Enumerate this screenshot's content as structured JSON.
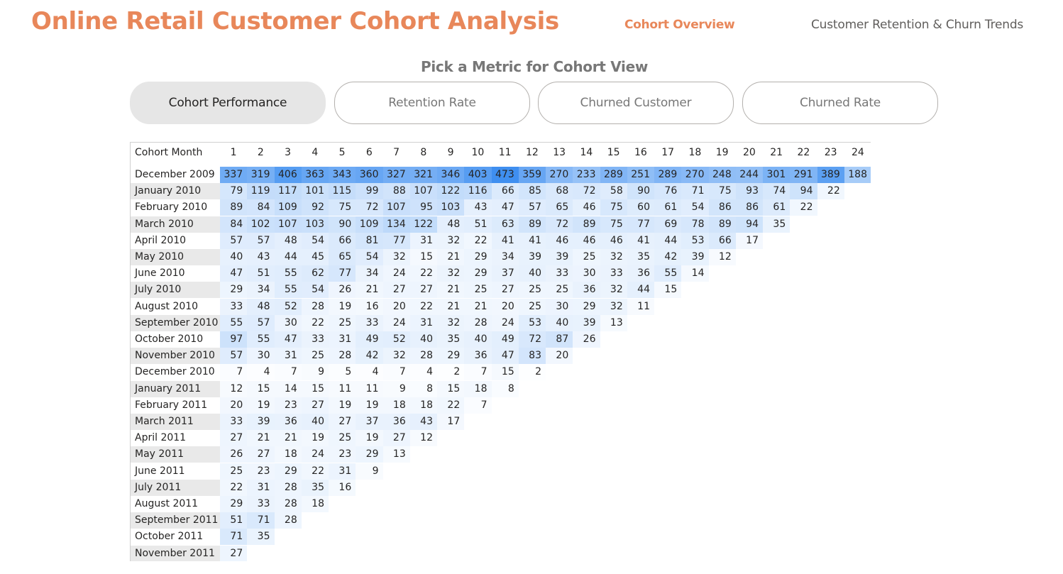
{
  "header": {
    "title": "Online Retail Customer Cohort Analysis",
    "nav_active": "Cohort Overview",
    "nav_inactive": "Customer Retention & Churn Trends"
  },
  "picker": {
    "title": "Pick a Metric for Cohort View",
    "buttons": [
      "Cohort Performance",
      "Retention Rate",
      "Churned Customer",
      "Churned Rate"
    ],
    "selected": "Cohort Performance"
  },
  "colors": {
    "title_accent": "#e8875a",
    "heat_low": "#ffffff",
    "heat_high": "#3f8ff0"
  },
  "table": {
    "corner_label": "Cohort Month",
    "columns": [
      "1",
      "2",
      "3",
      "4",
      "5",
      "6",
      "7",
      "8",
      "9",
      "10",
      "11",
      "12",
      "13",
      "14",
      "15",
      "16",
      "17",
      "18",
      "19",
      "20",
      "21",
      "22",
      "23",
      "24"
    ],
    "rows": [
      {
        "label": "December 2009",
        "values": [
          337,
          319,
          406,
          363,
          343,
          360,
          327,
          321,
          346,
          403,
          473,
          359,
          270,
          233,
          289,
          251,
          289,
          270,
          248,
          244,
          301,
          291,
          389,
          188
        ]
      },
      {
        "label": "January 2010",
        "values": [
          79,
          119,
          117,
          101,
          115,
          99,
          88,
          107,
          122,
          116,
          66,
          85,
          68,
          72,
          58,
          90,
          76,
          71,
          75,
          93,
          74,
          94,
          22
        ]
      },
      {
        "label": "February 2010",
        "values": [
          89,
          84,
          109,
          92,
          75,
          72,
          107,
          95,
          103,
          43,
          47,
          57,
          65,
          46,
          75,
          60,
          61,
          54,
          86,
          86,
          61,
          22
        ]
      },
      {
        "label": "March 2010",
        "values": [
          84,
          102,
          107,
          103,
          90,
          109,
          134,
          122,
          48,
          51,
          63,
          89,
          72,
          89,
          75,
          77,
          69,
          78,
          89,
          94,
          35
        ]
      },
      {
        "label": "April 2010",
        "values": [
          57,
          57,
          48,
          54,
          66,
          81,
          77,
          31,
          32,
          22,
          41,
          41,
          46,
          46,
          46,
          41,
          44,
          53,
          66,
          17
        ]
      },
      {
        "label": "May 2010",
        "values": [
          40,
          43,
          44,
          45,
          65,
          54,
          32,
          15,
          21,
          29,
          34,
          39,
          39,
          25,
          32,
          35,
          42,
          39,
          12
        ]
      },
      {
        "label": "June 2010",
        "values": [
          47,
          51,
          55,
          62,
          77,
          34,
          24,
          22,
          32,
          29,
          37,
          40,
          33,
          30,
          33,
          36,
          55,
          14
        ]
      },
      {
        "label": "July 2010",
        "values": [
          29,
          34,
          55,
          54,
          26,
          21,
          27,
          27,
          21,
          25,
          27,
          25,
          25,
          36,
          32,
          44,
          15
        ]
      },
      {
        "label": "August 2010",
        "values": [
          33,
          48,
          52,
          28,
          19,
          16,
          20,
          22,
          21,
          21,
          20,
          25,
          30,
          29,
          32,
          11
        ]
      },
      {
        "label": "September 2010",
        "values": [
          55,
          57,
          30,
          22,
          25,
          33,
          24,
          31,
          32,
          28,
          24,
          53,
          40,
          39,
          13
        ]
      },
      {
        "label": "October 2010",
        "values": [
          97,
          55,
          47,
          33,
          31,
          49,
          52,
          40,
          35,
          40,
          49,
          72,
          87,
          26
        ]
      },
      {
        "label": "November 2010",
        "values": [
          57,
          30,
          31,
          25,
          28,
          42,
          32,
          28,
          29,
          36,
          47,
          83,
          20
        ]
      },
      {
        "label": "December 2010",
        "values": [
          7,
          4,
          7,
          9,
          5,
          4,
          7,
          4,
          2,
          7,
          15,
          2
        ]
      },
      {
        "label": "January 2011",
        "values": [
          12,
          15,
          14,
          15,
          11,
          11,
          9,
          8,
          15,
          18,
          8
        ]
      },
      {
        "label": "February 2011",
        "values": [
          20,
          19,
          23,
          27,
          19,
          19,
          18,
          18,
          22,
          7
        ]
      },
      {
        "label": "March 2011",
        "values": [
          33,
          39,
          36,
          40,
          27,
          37,
          36,
          43,
          17
        ]
      },
      {
        "label": "April 2011",
        "values": [
          27,
          21,
          21,
          19,
          25,
          19,
          27,
          12
        ]
      },
      {
        "label": "May 2011",
        "values": [
          26,
          27,
          18,
          24,
          23,
          29,
          13
        ]
      },
      {
        "label": "June 2011",
        "values": [
          25,
          23,
          29,
          22,
          31,
          9
        ]
      },
      {
        "label": "July 2011",
        "values": [
          22,
          31,
          28,
          35,
          16
        ]
      },
      {
        "label": "August 2011",
        "values": [
          29,
          33,
          28,
          18
        ]
      },
      {
        "label": "September 2011",
        "values": [
          51,
          71,
          28
        ]
      },
      {
        "label": "October 2011",
        "values": [
          71,
          35
        ]
      },
      {
        "label": "November 2011",
        "values": [
          27
        ]
      }
    ]
  }
}
